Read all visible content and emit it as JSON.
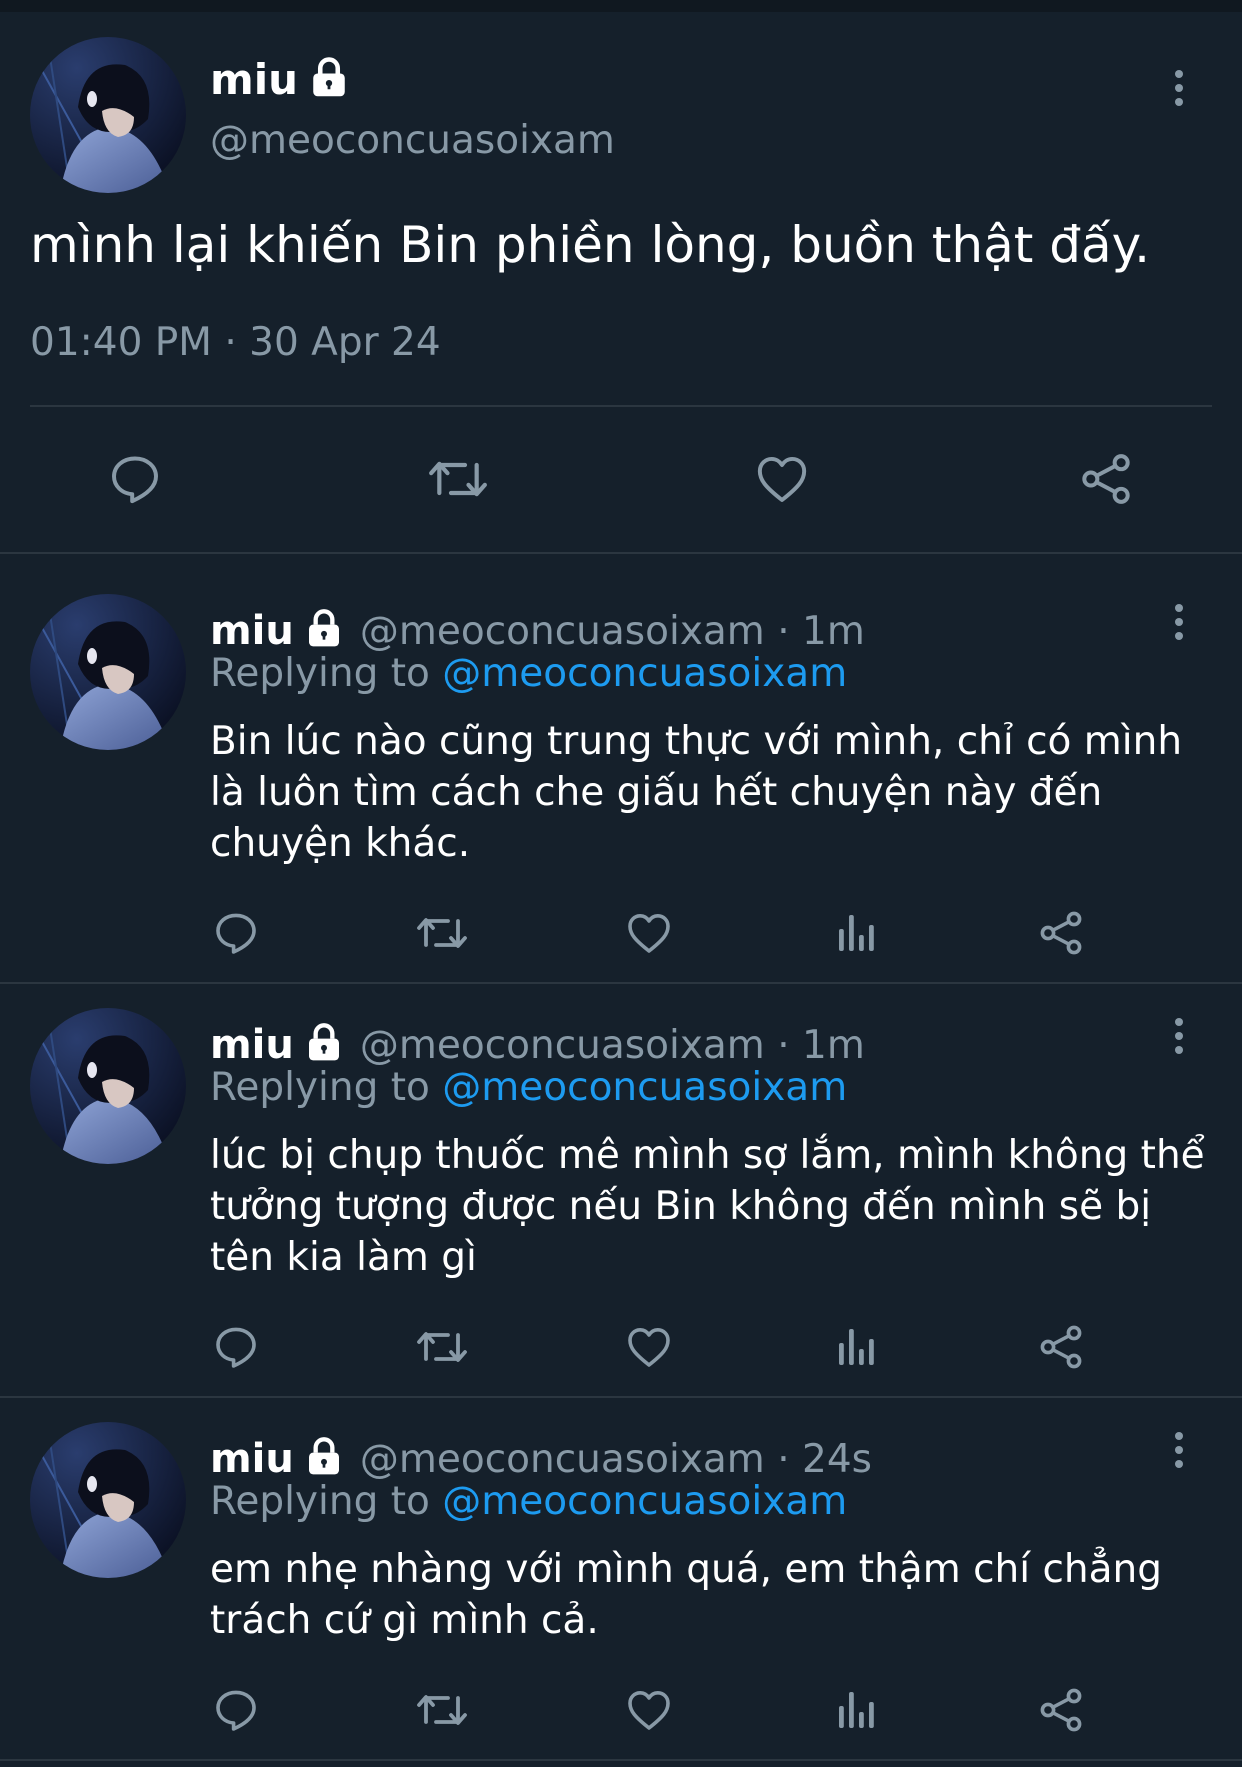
{
  "main_tweet": {
    "display_name": "miu",
    "handle": "@meoconcuasoixam",
    "text": "mình lại khiến Bin phiền lòng, buồn thật đấy.",
    "timestamp": "01:40 PM · 30 Apr 24",
    "icons": [
      "lock-icon",
      "more-icon",
      "reply-icon",
      "retweet-icon",
      "like-icon",
      "share-icon"
    ]
  },
  "replies": [
    {
      "display_name": "miu",
      "handle": "@meoconcuasoixam",
      "time_sep": " · ",
      "time": "1m",
      "replying_label": "Replying to ",
      "replying_to": "@meoconcuasoixam",
      "text": "Bin lúc nào cũng trung thực với mình, chỉ có mình là luôn tìm cách che giấu hết chuyện này đến chuyện khác."
    },
    {
      "display_name": "miu",
      "handle": "@meoconcuasoixam",
      "time_sep": " · ",
      "time": "1m",
      "replying_label": "Replying to ",
      "replying_to": "@meoconcuasoixam",
      "text": "lúc bị chụp thuốc mê mình sợ lắm, mình không thể tưởng tượng được nếu Bin không đến mình sẽ bị tên kia làm gì"
    },
    {
      "display_name": "miu",
      "handle": "@meoconcuasoixam",
      "time_sep": " · ",
      "time": "24s",
      "replying_label": "Replying to ",
      "replying_to": "@meoconcuasoixam",
      "text": "em nhẹ nhàng với mình quá, em thậm chí chẳng trách cứ gì mình cả."
    }
  ],
  "colors": {
    "background": "#15202b",
    "muted": "#8899a6",
    "link": "#1d9bf0",
    "divider": "#2b3640"
  }
}
